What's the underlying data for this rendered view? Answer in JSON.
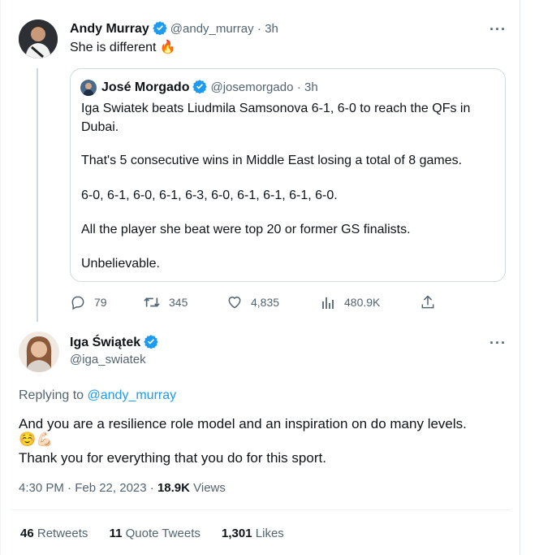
{
  "reply_tweet": {
    "author_name": "Andy Murray",
    "handle": "@andy_murray",
    "time": "· 3h",
    "text": "She is different 🔥",
    "more": "···"
  },
  "quoted_tweet": {
    "author_name": "José Morgado",
    "handle": "@josemorgado",
    "time": "· 3h",
    "lines": [
      "Iga Swiatek beats Liudmila Samsonova 6-1, 6-0 to reach the QFs in",
      "Dubai.",
      "That's 5 consecutive wins in Middle East losing a total of 8 games.",
      "6-0, 6-1, 6-0, 6-1, 6-3, 6-0, 6-1, 6-1, 6-1, 6-0.",
      "All the player she beat were top 20 or former GS finalists.",
      "Unbelievable."
    ]
  },
  "actions": {
    "replies": "79",
    "retweets": "345",
    "likes": "4,835",
    "views": "480.9K"
  },
  "main_tweet": {
    "author_name": "Iga Świątek",
    "handle": "@iga_swiatek",
    "more": "···",
    "replying_prefix": "Replying to",
    "replying_handle": "@andy_murray",
    "line1": "And you are a resilience role model and an inspiration on do many levels.",
    "emojis": "☺️💪🏻",
    "line2": "Thank you for everything that you do for this sport.",
    "timestamp": "4:30 PM · Feb 22, 2023 ·",
    "views_count": "18.9K",
    "views_label": "Views"
  },
  "stats": {
    "retweets_count": "46",
    "retweets_label": "Retweets",
    "quotes_count": "11",
    "quotes_label": "Quote Tweets",
    "likes_count": "1,301",
    "likes_label": "Likes"
  },
  "colors": {
    "accent": "#1d9bf0",
    "secondary_text": "#536471",
    "primary_text": "#0f1419",
    "border": "#cfd9de"
  },
  "icons": [
    "reply-icon",
    "retweet-icon",
    "like-icon",
    "views-icon",
    "share-icon",
    "verified-badge-icon",
    "more-icon"
  ]
}
